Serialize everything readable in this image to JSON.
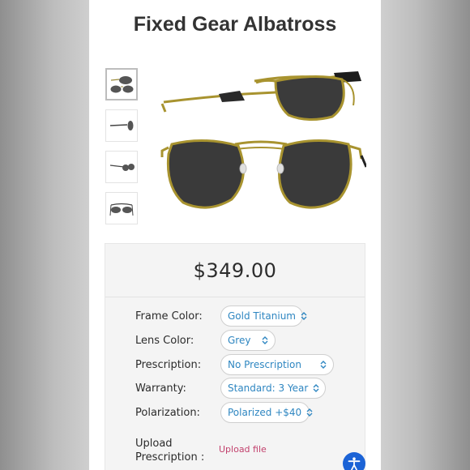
{
  "product": {
    "title": "Fixed Gear Albatross",
    "price": "$349.00"
  },
  "gallery": {
    "thumbnails": [
      "front-and-side-view",
      "side-view",
      "angled-view",
      "top-view"
    ],
    "active_index": 0
  },
  "options": {
    "frame_color": {
      "label": "Frame Color:",
      "value": "Gold Titanium"
    },
    "lens_color": {
      "label": "Lens Color:",
      "value": "Grey"
    },
    "prescription": {
      "label": "Prescription:",
      "value": "No Prescription"
    },
    "warranty": {
      "label": "Warranty:",
      "value": "Standard: 3 Year"
    },
    "polarization": {
      "label": "Polarization:",
      "value": "Polarized +$40"
    }
  },
  "upload": {
    "label_line1": "Upload",
    "label_line2": "Prescription :",
    "link": "Upload file"
  },
  "colors": {
    "select_text": "#2e86c1",
    "upload_link": "#c2416d",
    "accessibility_button": "#1b63d6"
  },
  "icons": [
    "chevron-updown-icon",
    "accessibility-icon"
  ]
}
